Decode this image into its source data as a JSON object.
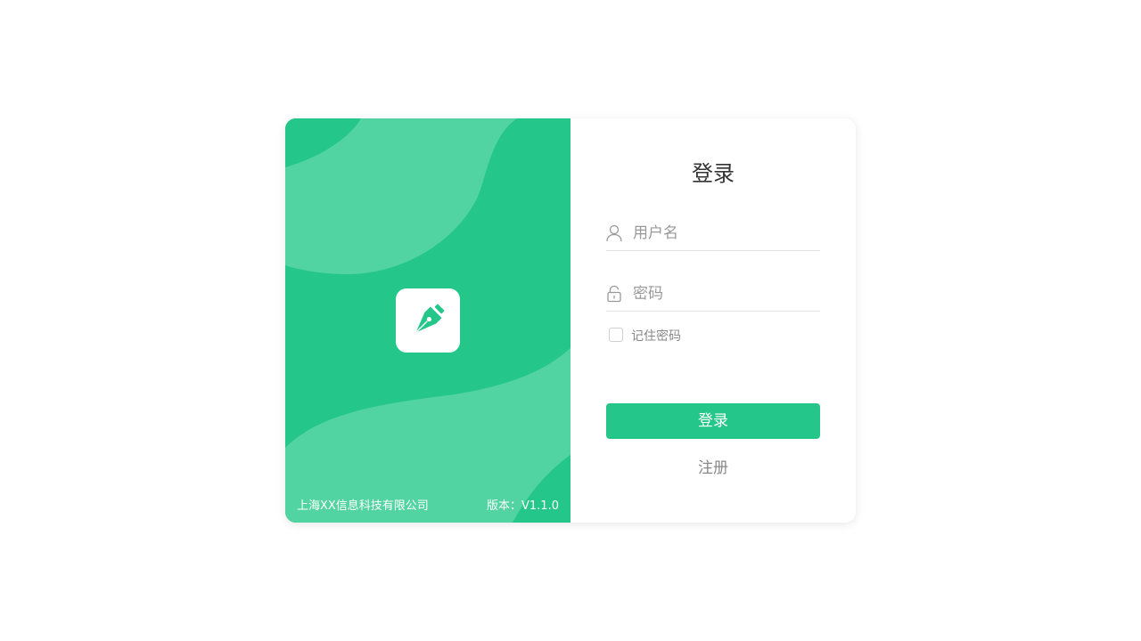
{
  "brand": {
    "company": "上海XX信息科技有限公司",
    "version": "版本：V1.1.0",
    "logo_icon": "pen-nib-icon"
  },
  "login_form": {
    "title": "登录",
    "username_placeholder": "用户名",
    "password_placeholder": "密码",
    "remember_label": "记住密码",
    "remember_checked": false,
    "login_button": "登录",
    "register_link": "注册"
  },
  "colors": {
    "accent": "#25c68a",
    "accent_light": "#52d3a2"
  }
}
